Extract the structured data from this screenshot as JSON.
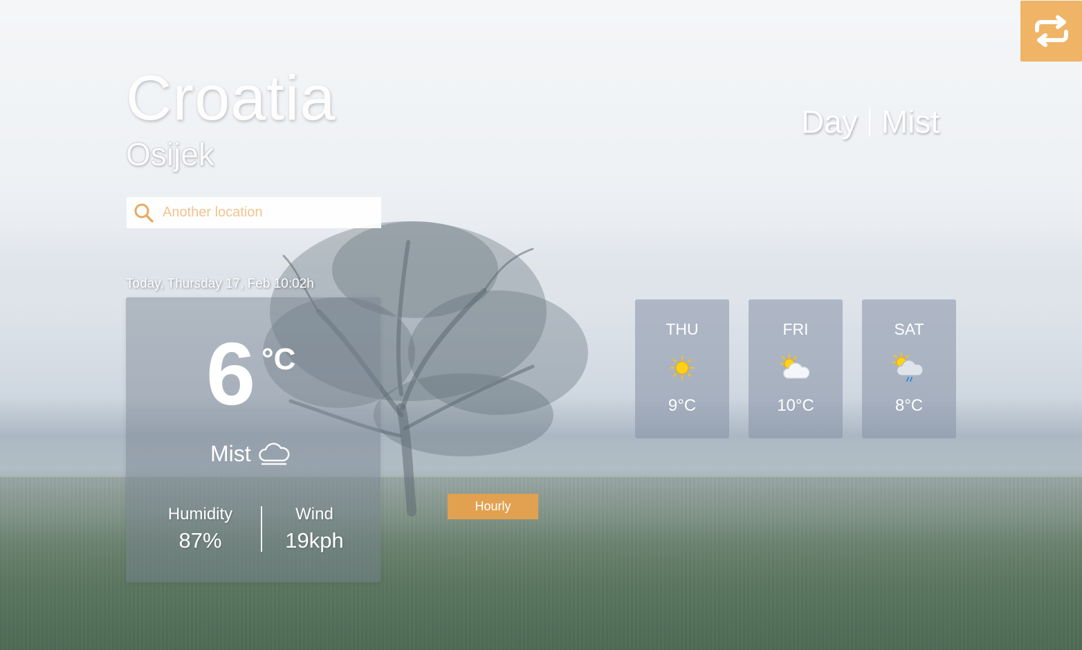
{
  "location": {
    "country": "Croatia",
    "city": "Osijek"
  },
  "period": {
    "time_of_day": "Day",
    "condition": "Mist"
  },
  "search": {
    "placeholder": "Another location",
    "icon": "search-icon"
  },
  "date_text": "Today, Thursday 17, Feb 10:02h",
  "current": {
    "temperature": "6",
    "unit": "°C",
    "condition": "Mist",
    "condition_icon": "cloud-outline-icon",
    "humidity_label": "Humidity",
    "humidity_value": "87%",
    "wind_label": "Wind",
    "wind_value": "19kph"
  },
  "hourly_label": "Hourly",
  "swap_icon": "swap-arrows-icon",
  "forecast": [
    {
      "day": "THU",
      "temp": "9°C",
      "icon": "sun-icon"
    },
    {
      "day": "FRI",
      "temp": "10°C",
      "icon": "partly-cloudy-icon"
    },
    {
      "day": "SAT",
      "temp": "8°C",
      "icon": "partly-cloudy-rain-icon"
    }
  ],
  "colors": {
    "accent": "#efb466",
    "hourly_button": "#e2a150",
    "placeholder": "#f2c48e"
  }
}
